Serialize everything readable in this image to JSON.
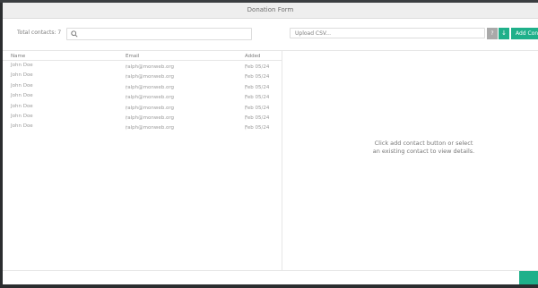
{
  "window": {
    "title": "Donation Form"
  },
  "toolbar": {
    "total_label": "Total contacts: 7",
    "search_placeholder": "",
    "upload_placeholder": "Upload CSV...",
    "help_label": "?",
    "download_label": "↓",
    "add_label": "Add Contact"
  },
  "table": {
    "columns": [
      "Name",
      "Email",
      "Added"
    ],
    "rows": [
      {
        "name": "John Doe",
        "email": "ralph@monweb.org",
        "added": "Feb 05/24"
      },
      {
        "name": "John Doe",
        "email": "ralph@monweb.org",
        "added": "Feb 05/24"
      },
      {
        "name": "John Doe",
        "email": "ralph@monweb.org",
        "added": "Feb 05/24"
      },
      {
        "name": "John Doe",
        "email": "ralph@monweb.org",
        "added": "Feb 05/24"
      },
      {
        "name": "John Doe",
        "email": "ralph@monweb.org",
        "added": "Feb 05/24"
      },
      {
        "name": "John Doe",
        "email": "ralph@monweb.org",
        "added": "Feb 05/24"
      },
      {
        "name": "John Doe",
        "email": "ralph@monweb.org",
        "added": "Feb 05/24"
      }
    ]
  },
  "detail": {
    "hint": "Click add contact button or select an existing contact to view details."
  },
  "colors": {
    "accent": "#1fb08a",
    "muted_button": "#a9a9a9"
  },
  "icons": {
    "search": "search-icon",
    "download": "download-icon",
    "help": "help-icon"
  }
}
